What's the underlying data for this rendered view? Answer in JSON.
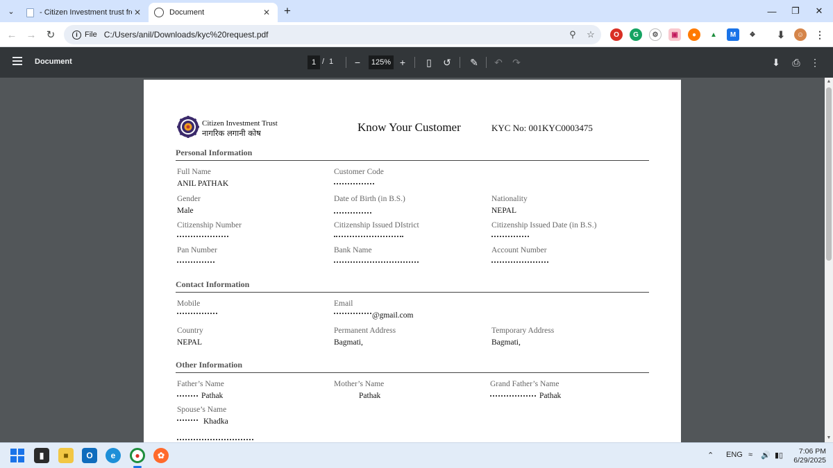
{
  "browser": {
    "tabs": [
      {
        "title": "- Citizen Investment trust from",
        "active": false
      },
      {
        "title": "Document",
        "active": true
      }
    ],
    "new_tab_symbol": "+",
    "site_chip": "File",
    "url": "C:/Users/anil/Downloads/kyc%20request.pdf"
  },
  "pdf_viewer": {
    "title": "Document",
    "page_current": "1",
    "page_separator": "/",
    "page_total": "1",
    "zoom": "125%"
  },
  "document": {
    "org_name_en": "Citizen Investment Trust",
    "org_name_np": "नागरिक लगानी कोष",
    "title": "Know Your Customer",
    "kyc_no": "KYC No: 001KYC0003475",
    "sections": {
      "personal": {
        "heading": "Personal Information",
        "fields": {
          "full_name": {
            "label": "Full Name",
            "value": "ANIL PATHAK"
          },
          "customer_code": {
            "label": "Customer Code",
            "value": ""
          },
          "gender": {
            "label": "Gender",
            "value": "Male"
          },
          "dob": {
            "label": "Date of Birth (in B.S.)",
            "value": ""
          },
          "nationality": {
            "label": "Nationality",
            "value": "NEPAL"
          },
          "citizenship_number": {
            "label": "Citizenship Number",
            "value": ""
          },
          "citizenship_district": {
            "label": "Citizenship Issued DIstrict",
            "value": ""
          },
          "citizenship_date": {
            "label": "Citizenship Issued Date (in B.S.)",
            "value": ""
          },
          "pan_number": {
            "label": "Pan Number",
            "value": ""
          },
          "bank_name": {
            "label": "Bank Name",
            "value": ""
          },
          "account_number": {
            "label": "Account Number",
            "value": ""
          }
        }
      },
      "contact": {
        "heading": "Contact Information",
        "fields": {
          "mobile": {
            "label": "Mobile",
            "value": ""
          },
          "email": {
            "label": "Email",
            "value": "@gmail.com"
          },
          "country": {
            "label": "Country",
            "value": "NEPAL"
          },
          "permanent_address": {
            "label": "Permanent Address",
            "value": "Bagmati,"
          },
          "temporary_address": {
            "label": "Temporary Address",
            "value": "Bagmati,"
          }
        }
      },
      "other": {
        "heading": "Other Information",
        "fields": {
          "father_name": {
            "label": "Father’s Name",
            "value": "Pathak"
          },
          "mother_name": {
            "label": "Mother’s Name",
            "value": "Pathak"
          },
          "grandfather_name": {
            "label": "Grand Father’s Name",
            "value": "Pathak"
          },
          "spouse_name": {
            "label": "Spouse’s Name",
            "value": "Khadka"
          }
        }
      }
    }
  },
  "taskbar": {
    "language": "ENG",
    "time": "7:06 PM",
    "date": "6/29/2025"
  },
  "colors": {
    "tabstrip": "#d3e3fd",
    "pdf_toolbar": "#323639",
    "viewer_background": "#525659",
    "taskbar": "#e2ecf8"
  }
}
